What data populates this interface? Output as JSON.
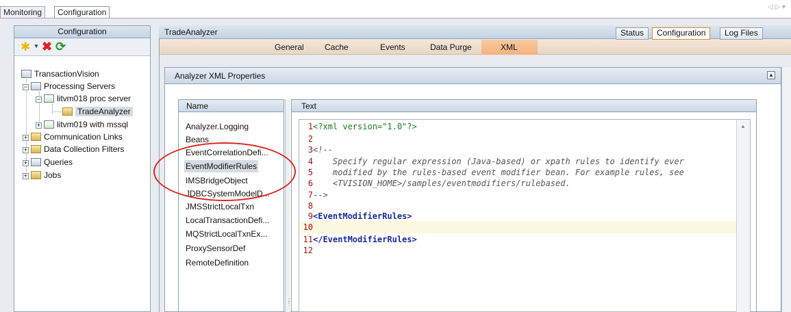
{
  "app_tabs": [
    {
      "label": "Monitoring",
      "active": false
    },
    {
      "label": "Configuration",
      "active": true
    }
  ],
  "nav_arrows": "◁ ▷ ▾",
  "left_panel": {
    "title": "Configuration",
    "toolbar": {
      "new_icon": "star-icon",
      "dropdown_icon": "chevron-down-icon",
      "delete_icon": "delete-x-icon",
      "refresh_icon": "refresh-icon"
    },
    "tree": [
      {
        "label": "TransactionVision",
        "level": 0
      },
      {
        "label": "Processing Servers",
        "level": 1
      },
      {
        "label": "litvm018 proc server",
        "level": 2
      },
      {
        "label": "TradeAnalyzer",
        "level": 3,
        "selected": true
      },
      {
        "label": "litvm019 with mssql",
        "level": 2
      },
      {
        "label": "Communication Links",
        "level": 1
      },
      {
        "label": "Data Collection Filters",
        "level": 1
      },
      {
        "label": "Queries",
        "level": 1
      },
      {
        "label": "Jobs",
        "level": 1
      }
    ]
  },
  "right_panel": {
    "title": "TradeAnalyzer",
    "tabs": [
      {
        "label": "Status",
        "active": false
      },
      {
        "label": "Configuration",
        "active": true
      },
      {
        "label": "Log Files",
        "active": false
      }
    ],
    "subtabs": [
      {
        "label": "General",
        "active": false
      },
      {
        "label": "Cache",
        "active": false
      },
      {
        "label": "Events",
        "active": false
      },
      {
        "label": "Data Purge",
        "active": false
      },
      {
        "label": "XML",
        "active": true
      }
    ],
    "section_title": "Analyzer XML Properties",
    "name_header": "Name",
    "text_header": "Text",
    "names": [
      "Analyzer.Logging",
      "Beans",
      "EventCorrelationDefi...",
      "EventModifierRules",
      "IMSBridgeObject",
      "JDBCSystemModelD...",
      "JMSStrictLocalTxn",
      "LocalTransactionDefi...",
      "MQStrictLocalTxnEx...",
      "ProxySensorDef",
      "RemoteDefinition"
    ],
    "selected_name": "EventModifierRules",
    "code_lines": [
      {
        "n": "1",
        "text": "<?xml version=\"1.0\"?>",
        "kind": "pi"
      },
      {
        "n": "2",
        "text": "",
        "kind": "plain"
      },
      {
        "n": "3",
        "text": "<!--",
        "kind": "cmt"
      },
      {
        "n": "4",
        "text": "    Specify regular expression (Java-based) or xpath rules to identify ever",
        "kind": "cmt"
      },
      {
        "n": "5",
        "text": "    modified by the rules-based event modifier bean. For example rules, see",
        "kind": "cmt"
      },
      {
        "n": "6",
        "text": "    <TVISION_HOME>/samples/eventmodifiers/rulebased.",
        "kind": "cmt"
      },
      {
        "n": "7",
        "text": "-->",
        "kind": "cmt"
      },
      {
        "n": "8",
        "text": "",
        "kind": "plain"
      },
      {
        "n": "9",
        "text": "<EventModifierRules>",
        "kind": "tag"
      },
      {
        "n": "10",
        "text": "",
        "kind": "plain",
        "highlight": true
      },
      {
        "n": "11",
        "text": "</EventModifierRules>",
        "kind": "tag"
      },
      {
        "n": "12",
        "text": "",
        "kind": "plain"
      }
    ]
  },
  "colors": {
    "annotation": "#d8261f",
    "active_subtab": "#f3b27e",
    "tag": "#1a2a9a",
    "line_number": "#a01010"
  }
}
